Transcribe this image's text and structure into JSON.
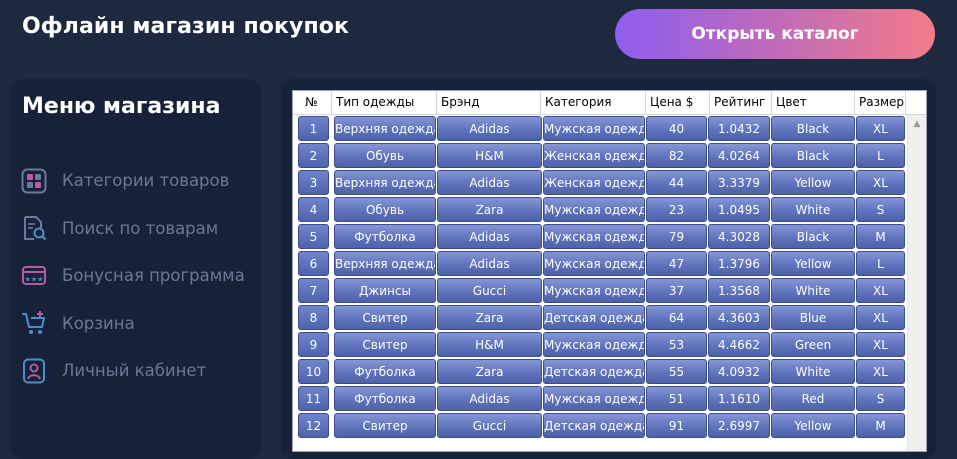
{
  "header": {
    "title": "Офлайн магазин покупок",
    "open_catalog_label": "Открыть каталог"
  },
  "sidebar": {
    "title": "Меню магазина",
    "items": [
      {
        "label": "Категории товаров",
        "icon": "categories-icon"
      },
      {
        "label": "Поиск по товарам",
        "icon": "search-products-icon"
      },
      {
        "label": "Бонусная программа",
        "icon": "bonus-card-icon"
      },
      {
        "label": "Корзина",
        "icon": "cart-icon"
      },
      {
        "label": "Личный кабинет",
        "icon": "user-account-icon"
      }
    ]
  },
  "table": {
    "columns": [
      "№",
      "Тип одежды",
      "Брэнд",
      "Категория",
      "Цена $",
      "Рейтинг",
      "Цвет",
      "Размер"
    ],
    "rows": [
      [
        "1",
        "Верхняя одежда",
        "Adidas",
        "Мужская одежда",
        "40",
        "1.0432",
        "Black",
        "XL"
      ],
      [
        "2",
        "Обувь",
        "H&M",
        "Женская одежда",
        "82",
        "4.0264",
        "Black",
        "L"
      ],
      [
        "3",
        "Верхняя одежда",
        "Adidas",
        "Женская одежда",
        "44",
        "3.3379",
        "Yellow",
        "XL"
      ],
      [
        "4",
        "Обувь",
        "Zara",
        "Мужская одежда",
        "23",
        "1.0495",
        "White",
        "S"
      ],
      [
        "5",
        "Футболка",
        "Adidas",
        "Мужская одежда",
        "79",
        "4.3028",
        "Black",
        "M"
      ],
      [
        "6",
        "Верхняя одежда",
        "Adidas",
        "Мужская одежда",
        "47",
        "1.3796",
        "Yellow",
        "L"
      ],
      [
        "7",
        "Джинсы",
        "Gucci",
        "Мужская одежда",
        "37",
        "1.3568",
        "White",
        "XL"
      ],
      [
        "8",
        "Свитер",
        "Zara",
        "Детская одежда",
        "64",
        "4.3603",
        "Blue",
        "XL"
      ],
      [
        "9",
        "Свитер",
        "H&M",
        "Мужская одежда",
        "53",
        "4.4662",
        "Green",
        "XL"
      ],
      [
        "10",
        "Футболка",
        "Zara",
        "Детская одежда",
        "55",
        "4.0932",
        "White",
        "XL"
      ],
      [
        "11",
        "Футболка",
        "Adidas",
        "Мужская одежда",
        "51",
        "1.1610",
        "Red",
        "S"
      ],
      [
        "12",
        "Свитер",
        "Gucci",
        "Детская одежда",
        "91",
        "2.6997",
        "Yellow",
        "M"
      ]
    ]
  },
  "colors": {
    "background": "#1e2940",
    "panel": "#17213a",
    "button_gradient_start": "#8e5df0",
    "button_gradient_end": "#f27b88",
    "cell": "#5f74bd",
    "menu_text": "#6c7891",
    "icon_accent": "#4a90c8"
  }
}
